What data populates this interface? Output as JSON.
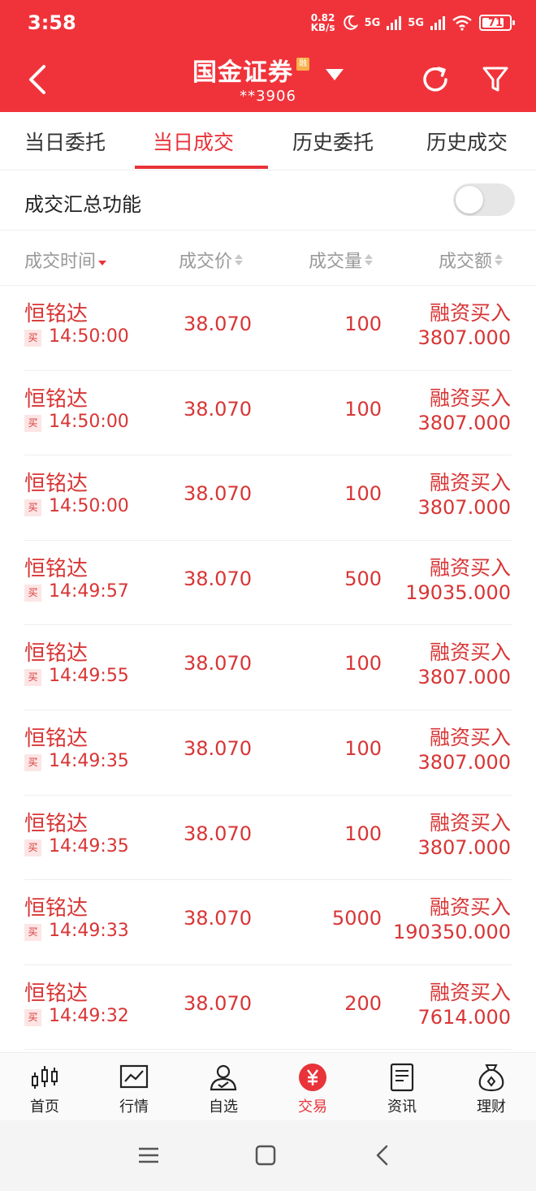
{
  "status_bar": {
    "time": "3:58",
    "net_speed_value": "0.82",
    "net_speed_unit": "KB/s",
    "signal1": "5G",
    "signal2": "5G",
    "battery": "71"
  },
  "header": {
    "title": "国金证券",
    "badge": "融",
    "account": "**3906"
  },
  "tabs": [
    {
      "label": "当日委托"
    },
    {
      "label": "当日成交"
    },
    {
      "label": "历史委托"
    },
    {
      "label": "历史成交"
    }
  ],
  "summary": {
    "label": "成交汇总功能",
    "enabled": false
  },
  "columns": {
    "time": "成交时间",
    "price": "成交价",
    "qty": "成交量",
    "amount": "成交额"
  },
  "trades": [
    {
      "name": "恒铭达",
      "side": "买",
      "time": "14:50:00",
      "price": "38.070",
      "qty": "100",
      "type": "融资买入",
      "amount": "3807.000"
    },
    {
      "name": "恒铭达",
      "side": "买",
      "time": "14:50:00",
      "price": "38.070",
      "qty": "100",
      "type": "融资买入",
      "amount": "3807.000"
    },
    {
      "name": "恒铭达",
      "side": "买",
      "time": "14:50:00",
      "price": "38.070",
      "qty": "100",
      "type": "融资买入",
      "amount": "3807.000"
    },
    {
      "name": "恒铭达",
      "side": "买",
      "time": "14:49:57",
      "price": "38.070",
      "qty": "500",
      "type": "融资买入",
      "amount": "19035.000"
    },
    {
      "name": "恒铭达",
      "side": "买",
      "time": "14:49:55",
      "price": "38.070",
      "qty": "100",
      "type": "融资买入",
      "amount": "3807.000"
    },
    {
      "name": "恒铭达",
      "side": "买",
      "time": "14:49:35",
      "price": "38.070",
      "qty": "100",
      "type": "融资买入",
      "amount": "3807.000"
    },
    {
      "name": "恒铭达",
      "side": "买",
      "time": "14:49:35",
      "price": "38.070",
      "qty": "100",
      "type": "融资买入",
      "amount": "3807.000"
    },
    {
      "name": "恒铭达",
      "side": "买",
      "time": "14:49:33",
      "price": "38.070",
      "qty": "5000",
      "type": "融资买入",
      "amount": "190350.000"
    },
    {
      "name": "恒铭达",
      "side": "买",
      "time": "14:49:32",
      "price": "38.070",
      "qty": "200",
      "type": "融资买入",
      "amount": "7614.000"
    }
  ],
  "bottom_nav": [
    {
      "label": "首页",
      "icon": "candlestick-icon"
    },
    {
      "label": "行情",
      "icon": "line-chart-icon"
    },
    {
      "label": "自选",
      "icon": "user-check-icon"
    },
    {
      "label": "交易",
      "icon": "yuan-icon"
    },
    {
      "label": "资讯",
      "icon": "document-icon"
    },
    {
      "label": "理财",
      "icon": "money-bag-icon"
    }
  ],
  "colors": {
    "brand_red": "#f0333a",
    "text_red": "#d83535",
    "muted": "#999999"
  }
}
